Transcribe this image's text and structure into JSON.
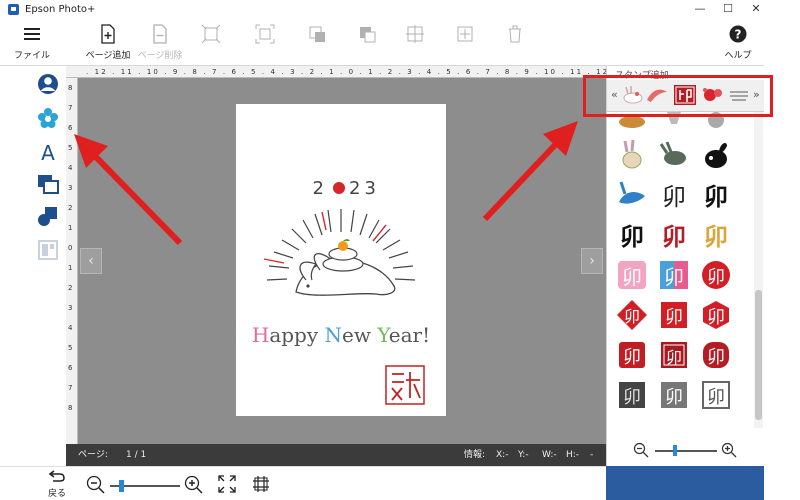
{
  "window": {
    "title": "Epson Photo+",
    "minimize": "—",
    "maximize": "☐",
    "close": "✕"
  },
  "toolbar": {
    "file_label": "ファイル",
    "add_page_label": "ページ追加",
    "delete_page_label": "ページ削除",
    "help_label": "ヘルプ"
  },
  "ruler": {
    "top_scale": ". 12 . 11 . 10 . 9 . 8 . 7 . 6 . 5 . 4 . 3 . 2 . 1 . 0 . 1 . 2 . 3 . 4 . 5 . 6 . 7 . 8 . 9 . 10 . 11 . 12",
    "left_scale": [
      "8",
      "7",
      "6",
      "5",
      "4",
      "3",
      "2",
      "1",
      "0",
      "1",
      "2",
      "3",
      "4",
      "5",
      "6",
      "7",
      "8"
    ]
  },
  "card": {
    "year_left": "2",
    "year_right": "23",
    "greeting": [
      {
        "t": "H",
        "c": "#e06aa8"
      },
      {
        "t": "appy ",
        "c": "#555555"
      },
      {
        "t": "N",
        "c": "#4aa0d8"
      },
      {
        "t": "ew ",
        "c": "#555555"
      },
      {
        "t": "Y",
        "c": "#6cbf4a"
      },
      {
        "t": "ear!",
        "c": "#555555"
      }
    ]
  },
  "canvas": {
    "prev_arrow": "‹",
    "next_arrow": "›"
  },
  "status": {
    "page_label": "ページ:",
    "page_value": "1 / 1",
    "info_label": "情報:",
    "x": "X:-",
    "y": "Y:-",
    "w": "W:-",
    "h": "H:-",
    "dash": "-"
  },
  "bottom": {
    "back_label": "戻る"
  },
  "stamp_panel": {
    "title": "スタンプ追加",
    "prev": "«",
    "next": "»"
  },
  "colors": {
    "accent_blue": "#2b5ca0",
    "highlight_red": "#e01f1f",
    "canvas_gray": "#8d8d8d",
    "status_dark": "#3b3b3b"
  }
}
